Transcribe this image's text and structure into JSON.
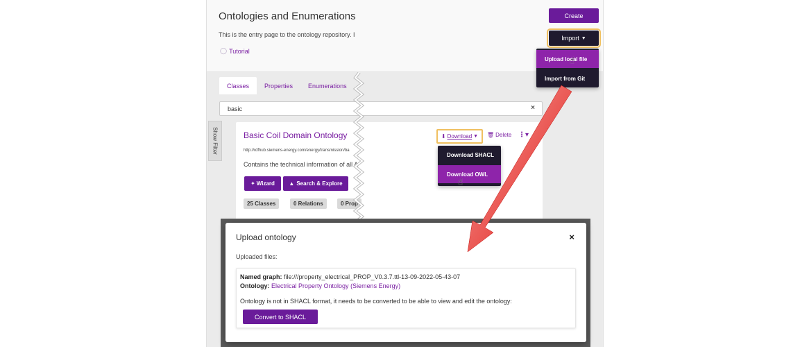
{
  "header": {
    "title": "Ontologies and Enumerations",
    "intro": "This is the entry page to the ontology repository. I",
    "tutorial_label": "Tutorial",
    "create_label": "Create",
    "import_label": "Import",
    "import_menu": [
      "Upload local file",
      "Import from Git"
    ]
  },
  "tabs": [
    "Classes",
    "Properties",
    "Enumerations"
  ],
  "search": {
    "value": "basic",
    "clear": "×"
  },
  "show_filter_label": "Show Filter",
  "card": {
    "title": "Basic Coil Domain Ontology",
    "uri": "http://rdfhub.siemens-energy.com/energy/transmission/ba",
    "description": "Contains the technical information of all A",
    "wizard_label": "Wizard",
    "search_explore_label": "Search & Explore",
    "download_label": "Download",
    "delete_label": "Delete",
    "download_menu": [
      "Download SHACL",
      "Download OWL"
    ],
    "badges": [
      "25 Classes",
      "0 Relations",
      "0 Prop"
    ]
  },
  "modal": {
    "title": "Upload ontology",
    "close": "×",
    "subtitle": "Uploaded files:",
    "named_graph_label": "Named graph:",
    "named_graph_value": "file:///property_electrical_PROP_V0.3.7.ttl-13-09-2022-05-43-07",
    "ontology_label": "Ontology:",
    "ontology_value": "Electrical Property Ontology (Siemens Energy)",
    "message": "Ontology is not in SHACL format, it needs to be converted to be able to view and edit the ontology:",
    "convert_label": "Convert to SHACL"
  },
  "colors": {
    "brand": "#6a1b9a",
    "menu_bg": "#1f1a2e",
    "menu_active": "#8e24aa",
    "highlight": "#f0c060",
    "arrow": "#e8221b"
  }
}
